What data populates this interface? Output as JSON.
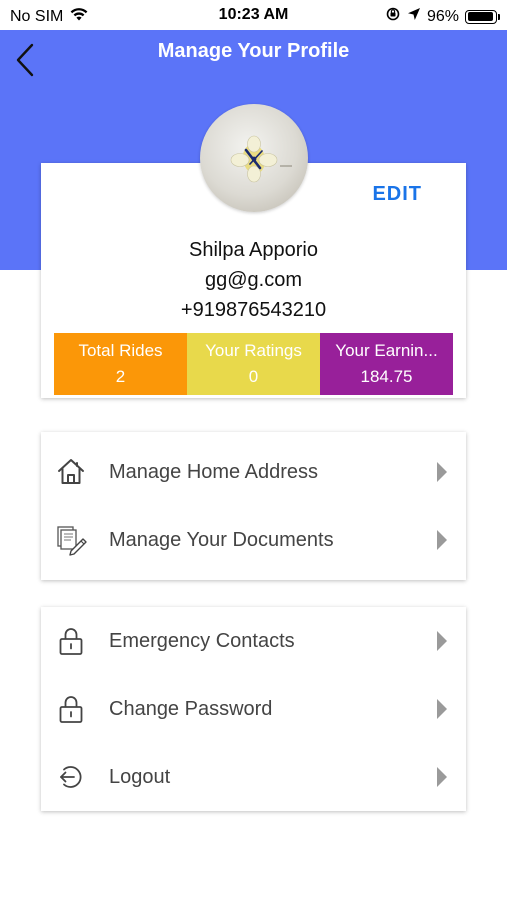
{
  "status_bar": {
    "carrier": "No SIM",
    "time": "10:23 AM",
    "battery": "96%",
    "battery_level": 0.96
  },
  "header": {
    "title": "Manage Your Profile",
    "bg_color": "#5b74f8"
  },
  "profile": {
    "edit_label": "EDIT",
    "name": "Shilpa Apporio",
    "email": "gg@g.com",
    "phone": "+919876543210",
    "stats": [
      {
        "label": "Total Rides",
        "value": "2",
        "color": "#fb9708"
      },
      {
        "label": "Your Ratings",
        "value": "0",
        "color": "#e8d94b"
      },
      {
        "label": "Your Earnin...",
        "value": "184.75",
        "color": "#98209a"
      }
    ]
  },
  "menu_primary": [
    {
      "label": "Manage Home Address",
      "icon": "home-icon"
    },
    {
      "label": "Manage Your Documents",
      "icon": "documents-icon"
    }
  ],
  "menu_secondary": [
    {
      "label": "Emergency Contacts",
      "icon": "lock-icon"
    },
    {
      "label": "Change Password",
      "icon": "lock-icon"
    },
    {
      "label": "Logout",
      "icon": "logout-icon"
    }
  ]
}
